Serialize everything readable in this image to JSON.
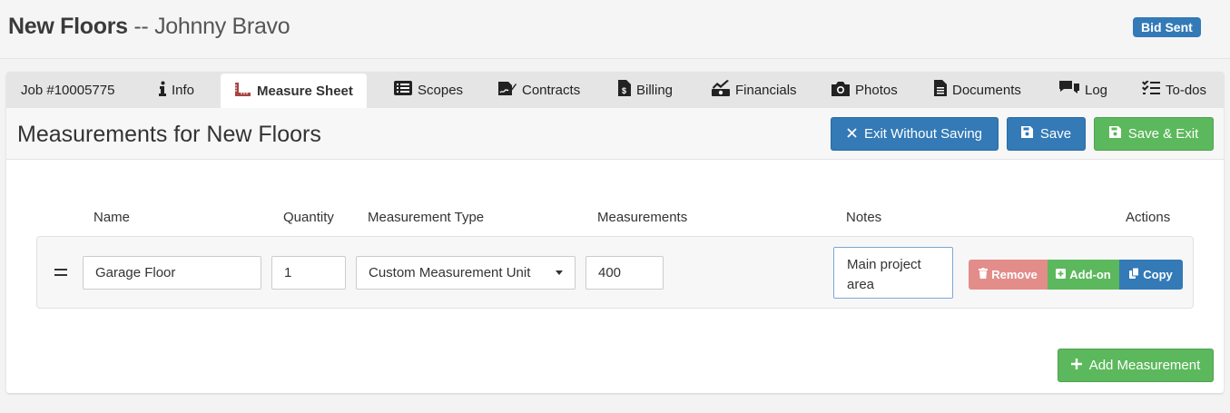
{
  "header": {
    "project_name": "New Floors",
    "separator": " -- ",
    "client_name": "Johnny Bravo",
    "status_badge": "Bid Sent",
    "status_color": "#337ab7"
  },
  "tabs": [
    {
      "label": "Job #10005775",
      "icon": "none",
      "active": false
    },
    {
      "label": "Info",
      "icon": "info-icon",
      "active": false
    },
    {
      "label": "Measure Sheet",
      "icon": "ruler-icon",
      "active": true
    },
    {
      "label": "Scopes",
      "icon": "list-icon",
      "active": false
    },
    {
      "label": "Contracts",
      "icon": "signature-icon",
      "active": false
    },
    {
      "label": "Billing",
      "icon": "invoice-icon",
      "active": false
    },
    {
      "label": "Financials",
      "icon": "money-chart-icon",
      "active": false
    },
    {
      "label": "Photos",
      "icon": "camera-icon",
      "active": false
    },
    {
      "label": "Documents",
      "icon": "document-icon",
      "active": false
    },
    {
      "label": "Log",
      "icon": "comments-icon",
      "active": false
    },
    {
      "label": "To-dos",
      "icon": "checklist-icon",
      "active": false
    }
  ],
  "section": {
    "title": "Measurements for New Floors",
    "exit_label": "Exit Without Saving",
    "save_label": "Save",
    "save_exit_label": "Save & Exit"
  },
  "columns": {
    "name": "Name",
    "quantity": "Quantity",
    "type": "Measurement Type",
    "measurements": "Measurements",
    "notes": "Notes",
    "actions": "Actions"
  },
  "rows": [
    {
      "name": "Garage Floor",
      "quantity": "1",
      "type": "Custom Measurement Unit",
      "measurements": "400",
      "notes": "Main project area",
      "remove_label": "Remove",
      "addon_label": "Add-on",
      "copy_label": "Copy"
    }
  ],
  "footer": {
    "add_label": "Add Measurement"
  },
  "colors": {
    "primary": "#337ab7",
    "success": "#5cb85c",
    "danger_muted": "#e38d8a"
  }
}
